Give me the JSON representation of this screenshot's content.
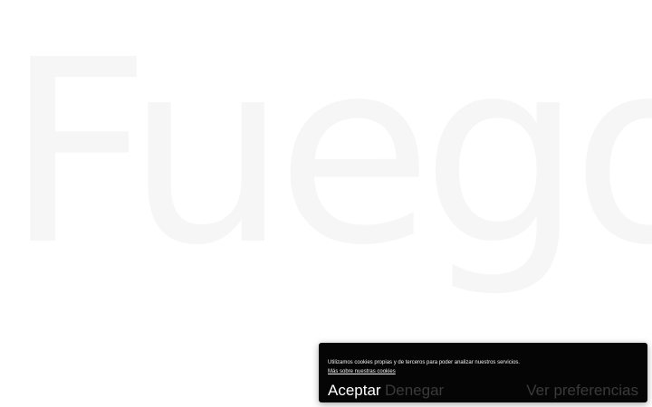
{
  "hero": {
    "wordmark": "Fuego",
    "wordmark_color": "#f6f6f6"
  },
  "cookie_banner": {
    "message": "Utilizamos cookies propias y de terceros para poder analizar nuestros servicios.",
    "more_link": "Más sobre nuestras cookies",
    "accept_label": "Aceptar",
    "deny_label": "Denegar",
    "preferences_label": "Ver preferencias",
    "background_color": "#050505",
    "accent_color": "#ffffff",
    "muted_color": "#3a3a3a"
  }
}
